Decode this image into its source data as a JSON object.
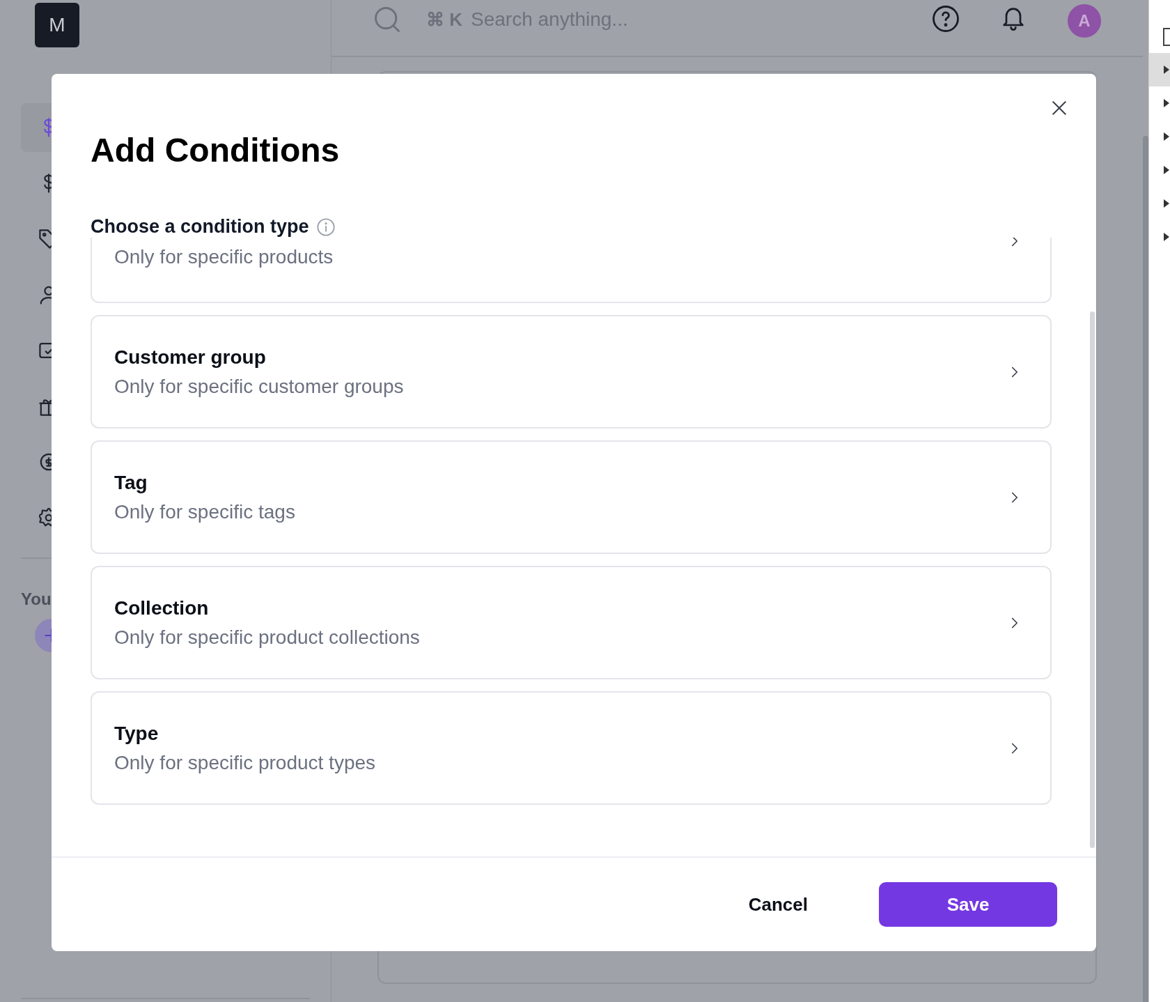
{
  "sidebar": {
    "logo": "M",
    "nav_items": [
      {
        "selected": true
      },
      {
        "selected": false
      },
      {
        "selected": false
      },
      {
        "selected": false
      },
      {
        "selected": false
      },
      {
        "selected": false
      },
      {
        "selected": false
      },
      {
        "selected": false
      }
    ],
    "section_label": "You"
  },
  "topbar": {
    "shortcut": "⌘ K",
    "search_placeholder": "Search anything...",
    "avatar": "A"
  },
  "modal": {
    "title": "Add Conditions",
    "label": "Choose a condition type",
    "options": [
      {
        "description": "Only for specific products"
      },
      {
        "title": "Customer group",
        "description": "Only for specific customer groups"
      },
      {
        "title": "Tag",
        "description": "Only for specific tags"
      },
      {
        "title": "Collection",
        "description": "Only for specific product collections"
      },
      {
        "title": "Type",
        "description": "Only for specific product types"
      }
    ],
    "cancel": "Cancel",
    "save": "Save"
  }
}
